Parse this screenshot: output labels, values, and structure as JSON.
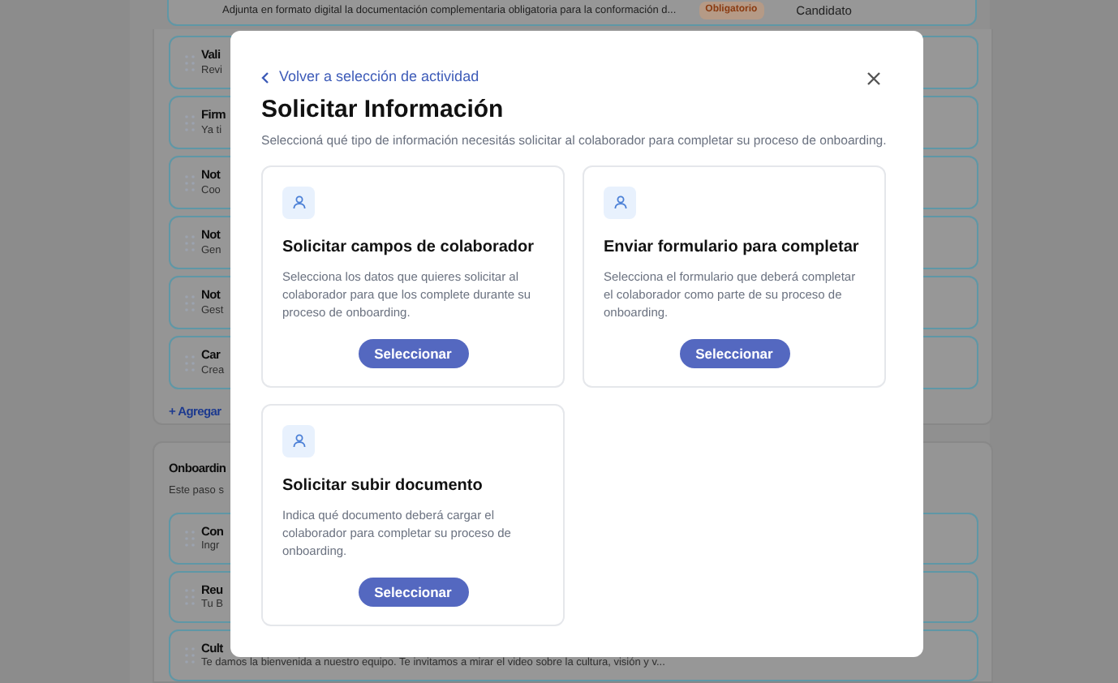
{
  "background": {
    "top_card": {
      "description": "Adjunta en formato digital la documentación complementaria obligatoria para la conformación d...",
      "badge": "Obligatorio",
      "role": "Candidato"
    },
    "items": [
      {
        "title": "Vali",
        "description": "Revi"
      },
      {
        "title": "Firm",
        "description": "Ya ti"
      },
      {
        "title": "Not",
        "description": "Coo"
      },
      {
        "title": "Not",
        "description": "Gen"
      },
      {
        "title": "Not",
        "description": "Gest"
      },
      {
        "title": "Car",
        "description": "Crea"
      }
    ],
    "add_link": "+ Agregar",
    "section": {
      "title": "Onboardin",
      "description": "Este paso s",
      "items": [
        {
          "title": "Con",
          "description": "Ingr"
        },
        {
          "title": "Reu",
          "description": "Tu B"
        },
        {
          "title": "Cult",
          "description": "Te damos la bienvenida a nuestro equipo. Te invitamos a mirar el video sobre la cultura, visión y v..."
        }
      ]
    }
  },
  "modal": {
    "back_link": "Volver a selección de actividad",
    "title": "Solicitar Información",
    "subtitle": "Seleccioná qué tipo de información necesitás solicitar al colaborador para completar su proceso de onboarding.",
    "options": [
      {
        "title": "Solicitar campos de colaborador",
        "description": "Selecciona los datos que quieres solicitar al colaborador para que los complete durante su proceso de onboarding.",
        "button": "Seleccionar"
      },
      {
        "title": "Enviar formulario para completar",
        "description": "Selecciona el formulario que deberá completar el colaborador como parte de su proceso de onboarding.",
        "button": "Seleccionar"
      },
      {
        "title": "Solicitar subir documento",
        "description": "Indica qué documento deberá cargar el colaborador para completar su proceso de onboarding.",
        "button": "Seleccionar"
      }
    ]
  }
}
